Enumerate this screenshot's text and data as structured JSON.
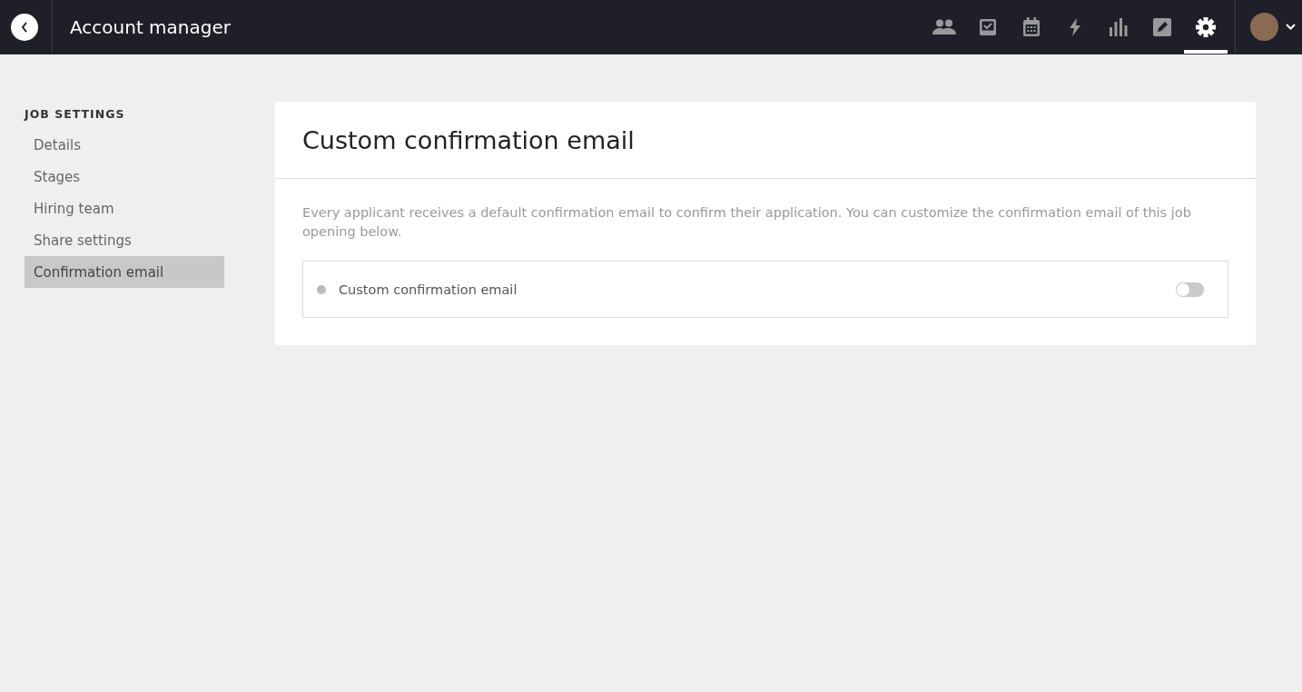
{
  "header": {
    "title": "Account manager",
    "nav": [
      {
        "kind": "people",
        "selected": false
      },
      {
        "kind": "tasks",
        "selected": false
      },
      {
        "kind": "calendar",
        "selected": false
      },
      {
        "kind": "bolt",
        "selected": false
      },
      {
        "kind": "chart",
        "selected": false
      },
      {
        "kind": "edit",
        "selected": false
      },
      {
        "kind": "settings",
        "selected": true
      }
    ]
  },
  "sidebar": {
    "heading": "JOB SETTINGS",
    "items": [
      {
        "label": "Details",
        "selected": false
      },
      {
        "label": "Stages",
        "selected": false
      },
      {
        "label": "Hiring team",
        "selected": false
      },
      {
        "label": "Share settings",
        "selected": false
      },
      {
        "label": "Confirmation email",
        "selected": true
      }
    ]
  },
  "card": {
    "title": "Custom confirmation email",
    "description": "Every applicant receives a default confirmation email to confirm their application. You can customize the confirmation email of this job opening below.",
    "setting": {
      "label": "Custom confirmation email",
      "on": false
    }
  }
}
